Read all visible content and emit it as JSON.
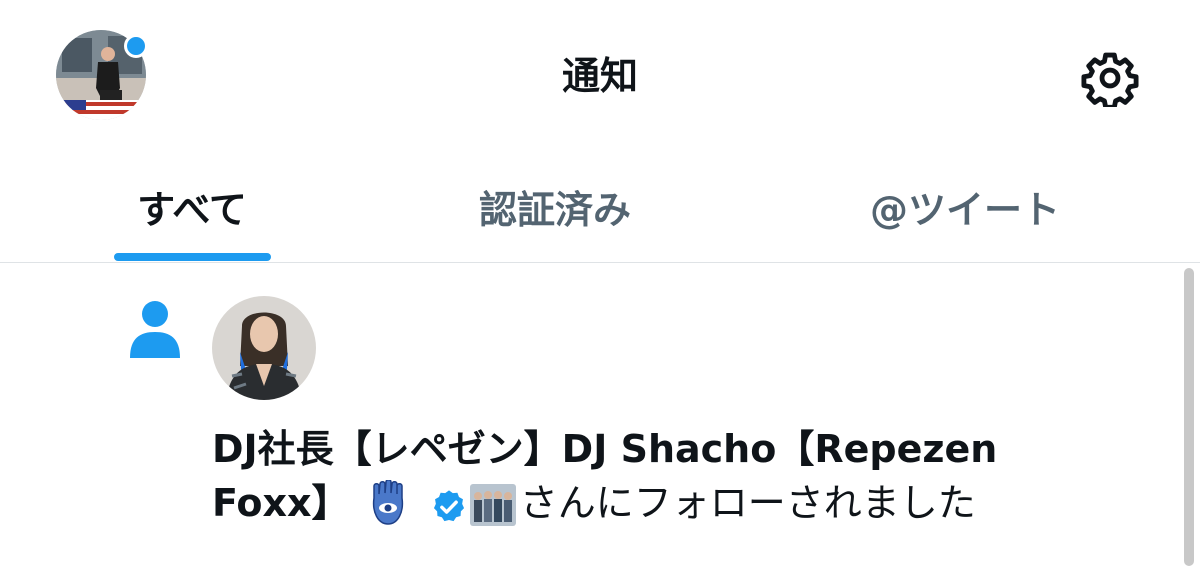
{
  "header": {
    "title": "通知",
    "avatar_icon": "profile-photo",
    "settings_icon": "gear-icon",
    "accent": "#1d9bf0"
  },
  "tabs": [
    {
      "label": "すべて",
      "active": true
    },
    {
      "label": "認証済み",
      "active": false
    },
    {
      "label": "@ツイート",
      "active": false
    }
  ],
  "notification": {
    "type_icon": "person-follow-icon",
    "user_name_line1": "DJ社長【レペゼン】DJ Shacho【Repezen",
    "user_name_line2": "Foxx】",
    "badges": [
      "hamsa-emoji",
      "verified-badge",
      "group-photo-emoji"
    ],
    "action_text": "さんにフォローされました"
  }
}
